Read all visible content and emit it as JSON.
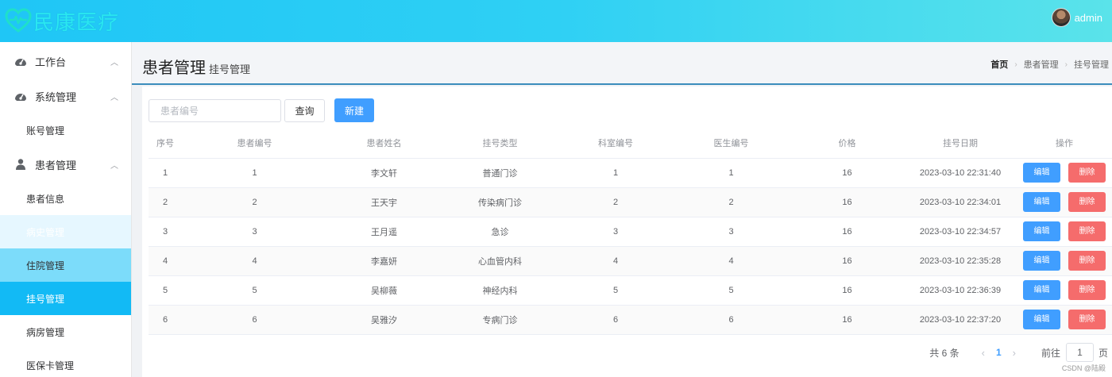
{
  "header": {
    "logo_text": "民康医疗",
    "username": "admin"
  },
  "sidebar": {
    "groups": [
      {
        "label": "工作台",
        "icon": "dashboard-icon"
      },
      {
        "label": "系统管理",
        "icon": "dashboard-icon",
        "items": [
          {
            "label": "账号管理"
          }
        ]
      },
      {
        "label": "患者管理",
        "icon": "user-icon",
        "items": [
          {
            "label": "患者信息"
          },
          {
            "label": "病史管理"
          },
          {
            "label": "住院管理"
          },
          {
            "label": "挂号管理"
          },
          {
            "label": "病房管理"
          },
          {
            "label": "医保卡管理"
          }
        ]
      }
    ]
  },
  "page": {
    "title": "患者管理",
    "subtitle": "挂号管理",
    "breadcrumb": [
      "首页",
      "患者管理",
      "挂号管理"
    ]
  },
  "toolbar": {
    "search_placeholder": "患者编号",
    "query_label": "查询",
    "new_label": "新建"
  },
  "table": {
    "columns": [
      "序号",
      "患者编号",
      "患者姓名",
      "挂号类型",
      "科室编号",
      "医生编号",
      "价格",
      "挂号日期",
      "操作"
    ],
    "rows": [
      [
        "1",
        "1",
        "李文轩",
        "普通门诊",
        "1",
        "1",
        "16",
        "2023-03-10 22:31:40"
      ],
      [
        "2",
        "2",
        "王天宇",
        "传染病门诊",
        "2",
        "2",
        "16",
        "2023-03-10 22:34:01"
      ],
      [
        "3",
        "3",
        "王月遥",
        "急诊",
        "3",
        "3",
        "16",
        "2023-03-10 22:34:57"
      ],
      [
        "4",
        "4",
        "李嘉妍",
        "心血管内科",
        "4",
        "4",
        "16",
        "2023-03-10 22:35:28"
      ],
      [
        "5",
        "5",
        "吴柳薇",
        "神经内科",
        "5",
        "5",
        "16",
        "2023-03-10 22:36:39"
      ],
      [
        "6",
        "6",
        "吴雅汐",
        "专病门诊",
        "6",
        "6",
        "16",
        "2023-03-10 22:37:20"
      ]
    ],
    "edit_label": "编辑",
    "delete_label": "删除"
  },
  "pagination": {
    "total_text": "共 6 条",
    "current_page": "1",
    "goto_label": "前往",
    "goto_value": "1",
    "page_suffix": "页"
  },
  "watermark": "CSDN @陆殿",
  "colors": {
    "primary": "#409eff",
    "danger": "#f56c6c",
    "active_menu": "#12baf5",
    "header_start": "#1fc6f6",
    "header_end": "#5ae3ea"
  }
}
